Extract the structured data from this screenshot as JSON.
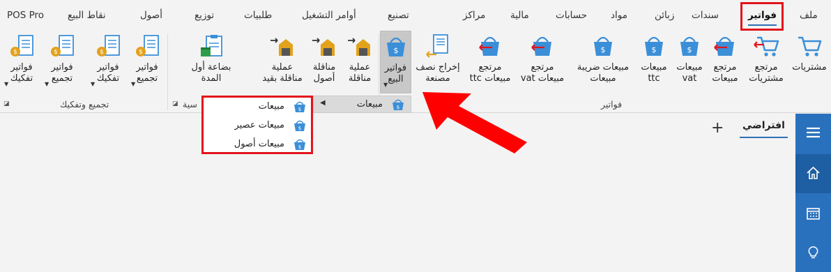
{
  "tabs": [
    {
      "id": "file",
      "label": "ملف"
    },
    {
      "id": "invoices",
      "label": "فواتير",
      "active": true
    },
    {
      "id": "vouchers",
      "label": "سندات"
    },
    {
      "id": "customers",
      "label": "زبائن"
    },
    {
      "id": "materials",
      "label": "مواد"
    },
    {
      "id": "accounts",
      "label": "حسابات"
    },
    {
      "id": "finance",
      "label": "مالية"
    },
    {
      "id": "centers",
      "label": "مراكز"
    },
    {
      "id": "manufacturing",
      "label": "تصنيع"
    },
    {
      "id": "work_orders",
      "label": "أوامر التشغيل"
    },
    {
      "id": "requests",
      "label": "طلبيات"
    },
    {
      "id": "distribution",
      "label": "توزيع"
    },
    {
      "id": "assets",
      "label": "أصول"
    },
    {
      "id": "pos",
      "label": "نقاط البيع"
    },
    {
      "id": "pos_pro",
      "label": "POS Pro"
    }
  ],
  "ribbon": {
    "invoices_group": {
      "label": "فواتير",
      "buttons": {
        "purchases": "مشتريات",
        "purchase_return": "مرتجع\nمشتريات",
        "sales_return": "مرتجع\nمبيعات",
        "sales_vat": "مبيعات\nvat",
        "sales_ttc": "مبيعات\nttc",
        "sales_tax": "مبيعات ضريبة\nمبيعات",
        "return_sales_vat": "مرتجع\nمبيعات vat",
        "return_sales_ttc": "مرتجع\nمبيعات ttc",
        "semi_finished": "إخراج نصف\nمصنعة",
        "sales_invoices": "فواتير\nالبيع"
      }
    },
    "transfer_group": {
      "label": "سية",
      "buttons": {
        "transfer_op": "عملية\nمناقلة",
        "asset_transfer": "مناقلة\nأصول",
        "transfer_with_entry": "عملية\nمناقلة بقيد",
        "opening_goods": "بضاعة أول\nالمدة"
      }
    },
    "assembly_group": {
      "label": "تجميع وتفكيك",
      "buttons": {
        "assembly_invoices_1": "فواتير\nتجميع",
        "disassembly_invoices_1": "فواتير\nتفكيك",
        "assembly_invoices_2": "فواتير\nتجميع",
        "disassembly_invoices_2": "فواتير\nتفكيك"
      }
    }
  },
  "submenu": {
    "label": "مبيعات"
  },
  "menu": {
    "items": [
      {
        "label": "مبيعات"
      },
      {
        "label": "مبيعات عصير"
      },
      {
        "label": "مبيعات أصول"
      }
    ]
  },
  "content": {
    "view_tab": "افتراضي",
    "add_symbol": "+"
  },
  "sidebar": {
    "items": [
      {
        "icon": "menu-icon"
      },
      {
        "icon": "home-icon"
      },
      {
        "icon": "calendar-icon"
      },
      {
        "icon": "lightbulb-icon"
      }
    ]
  },
  "colors": {
    "accent": "#2a71bd",
    "highlight": "#e3141b",
    "basket": "#3b8fd8"
  }
}
